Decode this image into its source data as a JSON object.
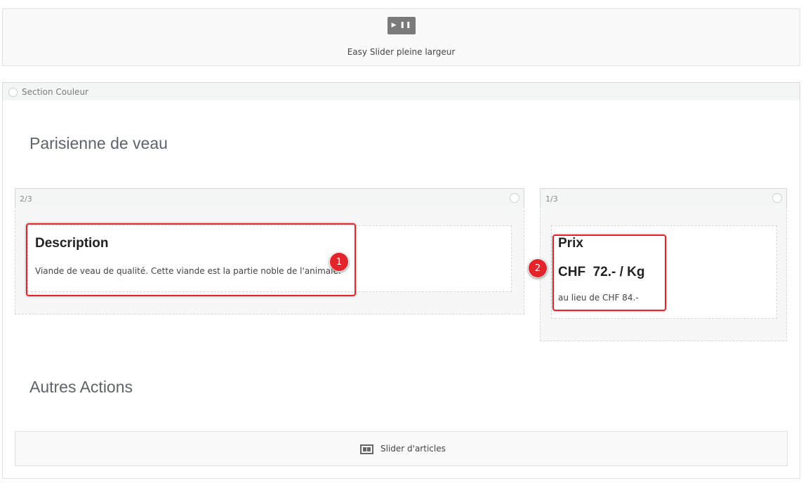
{
  "slider": {
    "play_pause": "▶ ❚❚",
    "label": "Easy Slider pleine largeur"
  },
  "section": {
    "label": "Section Couleur",
    "heading1": "Parisienne de veau",
    "heading2": "Autres Actions"
  },
  "columns": {
    "left": {
      "label": "2/3",
      "title": "Description",
      "text": "Viande de veau de qualité. Cette viande est la partie noble de l'animale."
    },
    "right": {
      "label": "1/3",
      "title": "Prix",
      "price": "CHF  72.- / Kg",
      "old_price": "au lieu de CHF 84.-"
    }
  },
  "badges": {
    "one": "1",
    "two": "2"
  },
  "articles": {
    "label": "Slider d'articles",
    "icon": "slider-icon"
  },
  "colors": {
    "callout": "#e3242b",
    "button": "#7a7a7a"
  }
}
